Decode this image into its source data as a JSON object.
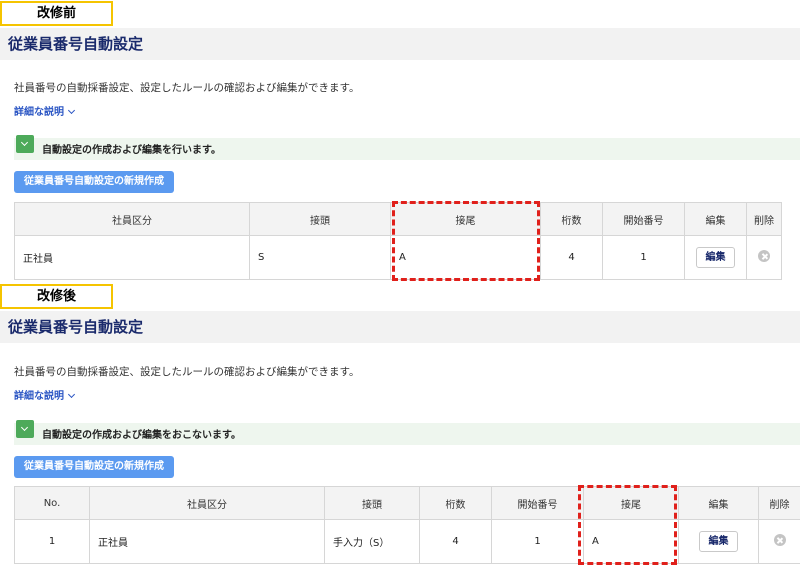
{
  "before": {
    "tag": "改修前",
    "title": "従業員番号自動設定",
    "description": "社員番号の自動採番設定、設定したルールの確認および編集ができます。",
    "detail_link": "詳細な説明",
    "notice": "自動設定の作成および編集を行います。",
    "create_button": "従業員番号自動設定の新規作成",
    "columns": [
      "社員区分",
      "接頭",
      "接尾",
      "桁数",
      "開始番号",
      "編集",
      "削除"
    ],
    "row": {
      "category": "正社員",
      "prefix": "S",
      "suffix": "A",
      "digits": "4",
      "start": "1",
      "edit": "編集"
    }
  },
  "after": {
    "tag": "改修後",
    "title": "従業員番号自動設定",
    "description": "社員番号の自動採番設定、設定したルールの確認および編集ができます。",
    "detail_link": "詳細な説明",
    "notice": "自動設定の作成および編集をおこないます。",
    "create_button": "従業員番号自動設定の新規作成",
    "columns": [
      "No.",
      "社員区分",
      "接頭",
      "桁数",
      "開始番号",
      "接尾",
      "編集",
      "削除"
    ],
    "row": {
      "no": "1",
      "category": "正社員",
      "prefix": "手入力（S）",
      "digits": "4",
      "start": "1",
      "suffix": "A",
      "edit": "編集"
    }
  },
  "colors": {
    "highlight": "#e0201b",
    "tag_border": "#f5c400",
    "primary": "#5b9af0",
    "notice_icon": "#4daa5a"
  },
  "icons": [
    "chevron-down-icon",
    "check-chevron-icon",
    "delete-circle-icon"
  ]
}
